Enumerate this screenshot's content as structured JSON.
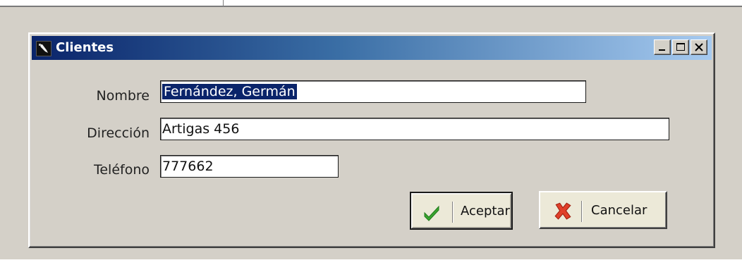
{
  "window": {
    "title": "Clientes",
    "controls": {
      "minimize": "minimize",
      "maximize": "maximize",
      "close": "close"
    }
  },
  "form": {
    "nombre": {
      "label": "Nombre",
      "value": "Fernández, Germán"
    },
    "direccion": {
      "label": "Dirección",
      "value": "Artigas 456"
    },
    "telefono": {
      "label": "Teléfono",
      "value": "777662"
    }
  },
  "buttons": {
    "accept": {
      "label": "Aceptar",
      "icon": "check-icon",
      "color": "#3aa530"
    },
    "cancel": {
      "label": "Cancelar",
      "icon": "x-icon",
      "color": "#e0402a"
    }
  },
  "colors": {
    "title_start": "#0a246a",
    "title_end": "#a6caf0",
    "selection": "#0a246a"
  }
}
